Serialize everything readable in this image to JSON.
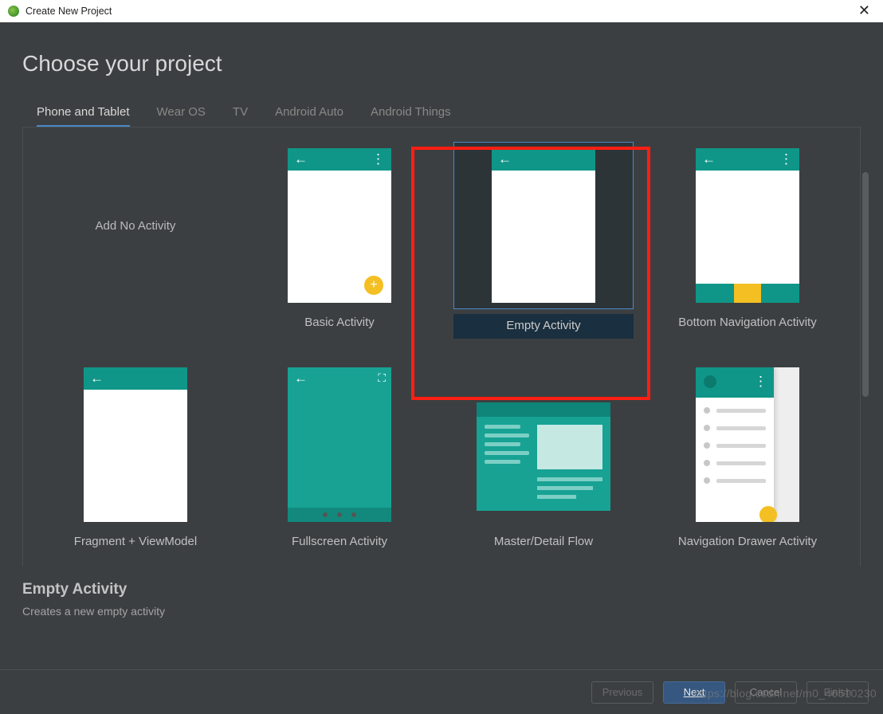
{
  "window": {
    "title": "Create New Project"
  },
  "heading": "Choose your project",
  "tabs": [
    {
      "label": "Phone and Tablet",
      "active": true
    },
    {
      "label": "Wear OS",
      "active": false
    },
    {
      "label": "TV",
      "active": false
    },
    {
      "label": "Android Auto",
      "active": false
    },
    {
      "label": "Android Things",
      "active": false
    }
  ],
  "templates": [
    {
      "key": "add-no-activity",
      "label": "Add No Activity"
    },
    {
      "key": "basic-activity",
      "label": "Basic Activity"
    },
    {
      "key": "empty-activity",
      "label": "Empty Activity",
      "selected": true
    },
    {
      "key": "bottom-navigation-activity",
      "label": "Bottom Navigation Activity"
    },
    {
      "key": "fragment-viewmodel",
      "label": "Fragment + ViewModel"
    },
    {
      "key": "fullscreen-activity",
      "label": "Fullscreen Activity"
    },
    {
      "key": "master-detail-flow",
      "label": "Master/Detail Flow"
    },
    {
      "key": "navigation-drawer-activity",
      "label": "Navigation Drawer Activity"
    }
  ],
  "description": {
    "title": "Empty Activity",
    "subtitle": "Creates a new empty activity"
  },
  "buttons": {
    "previous": "Previous",
    "next": "Next",
    "cancel": "Cancel",
    "finish": "Finish"
  },
  "watermark": "https://blog.csdn.net/m0_46510230"
}
